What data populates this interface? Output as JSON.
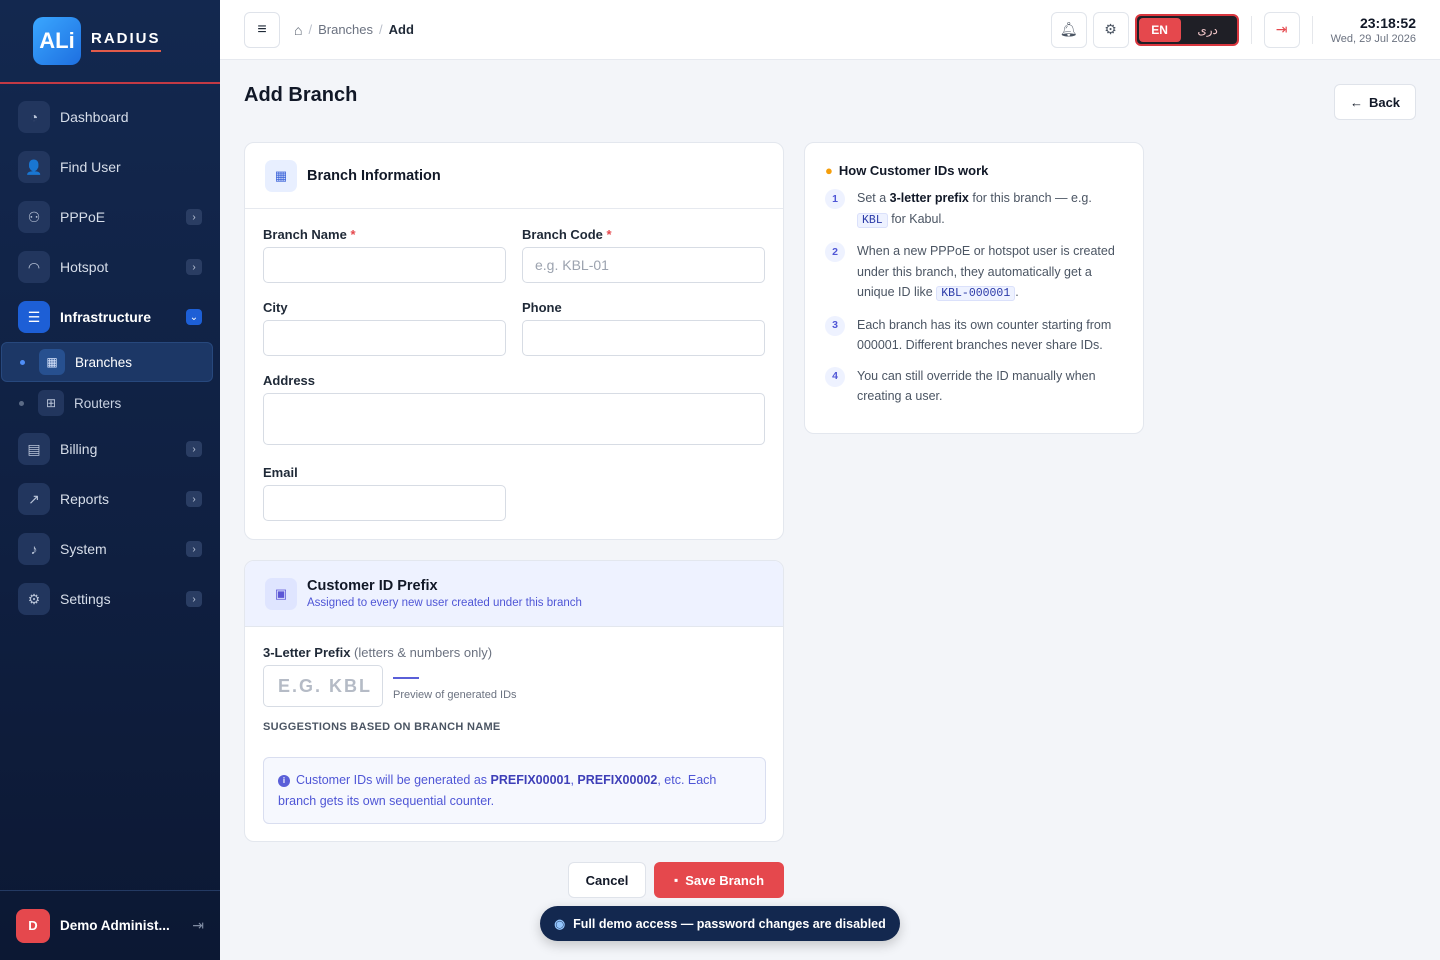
{
  "brand": {
    "logo_text": "ALi",
    "name": "RADIUS"
  },
  "sidebar": {
    "items": [
      {
        "label": "Dashboard",
        "icon": "gauge-icon"
      },
      {
        "label": "Find User",
        "icon": "user-check-icon"
      },
      {
        "label": "PPPoE",
        "icon": "users-icon"
      },
      {
        "label": "Hotspot",
        "icon": "wifi-icon"
      },
      {
        "label": "Infrastructure",
        "icon": "server-icon"
      },
      {
        "label": "Billing",
        "icon": "wallet-icon"
      },
      {
        "label": "Reports",
        "icon": "chart-line-icon"
      },
      {
        "label": "System",
        "icon": "bell-icon"
      },
      {
        "label": "Settings",
        "icon": "gear-icon"
      }
    ],
    "sub_items": [
      {
        "label": "Branches",
        "icon": "building-icon"
      },
      {
        "label": "Routers",
        "icon": "network-icon"
      }
    ],
    "user": {
      "initial": "D",
      "name": "Demo Administ..."
    }
  },
  "header": {
    "breadcrumb": {
      "parent": "Branches",
      "current": "Add"
    },
    "lang": {
      "en": "EN",
      "dari": "دری"
    },
    "clock": {
      "time": "23:18:52",
      "date": "Wed, 29 Jul 2026"
    }
  },
  "page": {
    "title": "Add Branch",
    "back_label": "Back"
  },
  "branch_form": {
    "title": "Branch Information",
    "name_label": "Branch Name",
    "code_label": "Branch Code",
    "code_placeholder": "e.g. KBL-01",
    "city_label": "City",
    "phone_label": "Phone",
    "address_label": "Address",
    "email_label": "Email",
    "required_mark": "*"
  },
  "prefix": {
    "title": "Customer ID Prefix",
    "subtitle": "Assigned to every new user created under this branch",
    "label": "3-Letter Prefix",
    "label_hint": "(letters & numbers only)",
    "placeholder": "E.G. KBL",
    "preview_label": "Preview of generated IDs",
    "suggestions_label": "SUGGESTIONS BASED ON BRANCH NAME",
    "info_pre": "Customer IDs will be generated as ",
    "info_code1": "PREFIX00001",
    "info_comma": ", ",
    "info_code2": "PREFIX00002",
    "info_post": ", etc. Each branch gets its own sequential counter."
  },
  "help": {
    "title": "How Customer IDs work",
    "steps": [
      {
        "num": "1",
        "a": "Set a ",
        "b": "3-letter prefix",
        "c": " for this branch — e.g. ",
        "code": "KBL",
        "d": " for Kabul."
      },
      {
        "num": "2",
        "a": "When a new PPPoE or hotspot user is created under this branch, they automatically get a unique ID like ",
        "code": "KBL-000001",
        "d": "."
      },
      {
        "num": "3",
        "a": "Each branch has its own counter starting from 000001. Different branches never share IDs."
      },
      {
        "num": "4",
        "a": "You can still override the ID manually when creating a user."
      }
    ]
  },
  "actions": {
    "cancel": "Cancel",
    "save": "Save Branch"
  },
  "toast": "Full demo access — password changes are disabled",
  "colors": {
    "accent": "#e5484d",
    "sidebar": "#13284f",
    "primary": "#1d5fd6",
    "indigo": "#4f56d6"
  }
}
